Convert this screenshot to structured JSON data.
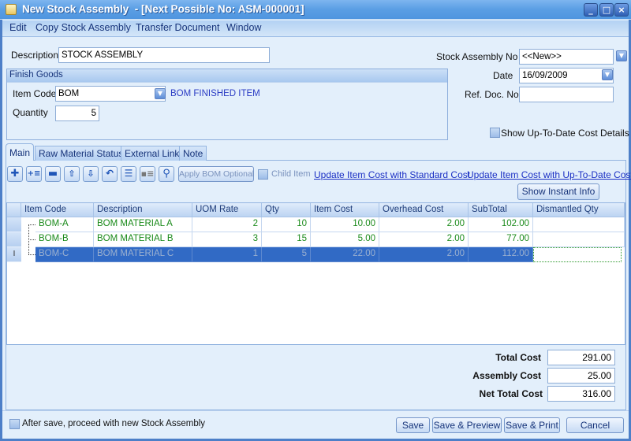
{
  "window": {
    "title": "New Stock Assembly  - [Next Possible No: ASM-000001]",
    "controls": {
      "minimize": "_",
      "maximize": "□",
      "close": "×"
    }
  },
  "menu": [
    "Edit",
    "Copy Stock Assembly",
    "Transfer Document",
    "Window"
  ],
  "header": {
    "description_label": "Description",
    "description_value": "STOCK ASSEMBLY",
    "finish_goods": {
      "title": "Finish Goods",
      "item_code_label": "Item Code",
      "item_code_value": "BOM",
      "item_description": "BOM FINISHED ITEM",
      "quantity_label": "Quantity",
      "quantity_value": "5"
    },
    "stock_assembly_no_label": "Stock Assembly No",
    "stock_assembly_no_value": "<<New>>",
    "date_label": "Date",
    "date_value": "16/09/2009",
    "ref_doc_no_label": "Ref. Doc. No",
    "ref_doc_no_value": "",
    "show_cost_details_label": "Show Up-To-Date Cost Details",
    "show_cost_details_checked": false
  },
  "tabs": [
    {
      "label": "Main",
      "active": true
    },
    {
      "label": "Raw Material Status",
      "active": false
    },
    {
      "label": "External Link",
      "active": false
    },
    {
      "label": "Note",
      "active": false
    }
  ],
  "toolbar": {
    "icons": [
      "add-icon",
      "insert-icon",
      "delete-icon",
      "move-up-icon",
      "move-down-icon",
      "undo-icon",
      "list-icon",
      "detail-icon",
      "search-icon"
    ],
    "apply_bom_optional": "Apply BOM Optional",
    "child_item_label": "Child Item",
    "update_standard_cost": "Update Item Cost with Standard Cost",
    "update_uptodate_cost": "Update Item Cost with Up-To-Date Cost",
    "show_instant_info": "Show Instant Info"
  },
  "grid": {
    "columns": [
      "Item Code",
      "Description",
      "UOM Rate",
      "Qty",
      "Item Cost",
      "Overhead Cost",
      "SubTotal",
      "Dismantled Qty"
    ],
    "rows": [
      {
        "item_code": "BOM-A",
        "description": "BOM MATERIAL A",
        "uom_rate": "2",
        "qty": "10",
        "item_cost": "10.00",
        "overhead_cost": "2.00",
        "subtotal": "102.00",
        "dismantled_qty": "",
        "selected": false
      },
      {
        "item_code": "BOM-B",
        "description": "BOM MATERIAL B",
        "uom_rate": "3",
        "qty": "15",
        "item_cost": "5.00",
        "overhead_cost": "2.00",
        "subtotal": "77.00",
        "dismantled_qty": "",
        "selected": false
      },
      {
        "item_code": "BOM-C",
        "description": "BOM MATERIAL C",
        "uom_rate": "1",
        "qty": "5",
        "item_cost": "22.00",
        "overhead_cost": "2.00",
        "subtotal": "112.00",
        "dismantled_qty": "",
        "selected": true
      }
    ],
    "edit_cursor": "I"
  },
  "totals": {
    "total_cost_label": "Total Cost",
    "total_cost": "291.00",
    "assembly_cost_label": "Assembly Cost",
    "assembly_cost": "25.00",
    "net_total_cost_label": "Net Total Cost",
    "net_total_cost": "316.00"
  },
  "footer": {
    "proceed_new_label": "After save, proceed with new Stock Assembly",
    "proceed_new_checked": false,
    "save": "Save",
    "save_preview": "Save & Preview",
    "save_print": "Save & Print",
    "cancel": "Cancel"
  }
}
